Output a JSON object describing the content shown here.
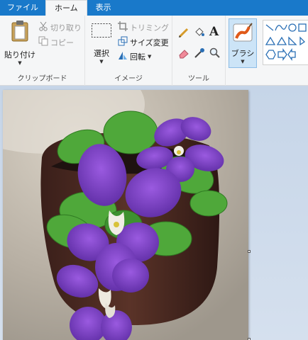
{
  "tabs": [
    {
      "label": "ファイル"
    },
    {
      "label": "ホーム"
    },
    {
      "label": "表示"
    }
  ],
  "clipboard": {
    "paste_label": "貼り付け",
    "cut_label": "切り取り",
    "copy_label": "コピー",
    "group_label": "クリップボード"
  },
  "image": {
    "select_label": "選択",
    "crop_label": "トリミング",
    "resize_label": "サイズ変更",
    "rotate_label": "回転",
    "group_label": "イメージ"
  },
  "tools": {
    "group_label": "ツール"
  },
  "brushes": {
    "label": "ブラシ"
  },
  "colors": {
    "tabbar": "#1979ca",
    "ribbon": "#f5f6f7",
    "workspace": "#c6d5e8",
    "selected_tool": "#cce4f7",
    "petal": "#7a3fc8",
    "leaf": "#4fa83a",
    "pot": "#4a2a22"
  }
}
